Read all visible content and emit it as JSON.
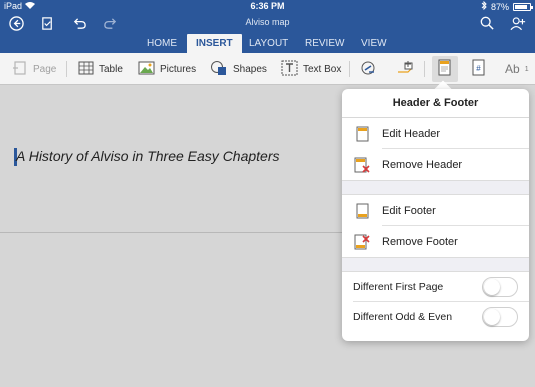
{
  "status": {
    "device": "iPad",
    "time": "6:36 PM",
    "battery": "87%"
  },
  "document": {
    "title": "Alviso map",
    "heading": "A History of Alviso in Three Easy Chapters"
  },
  "tabs": [
    {
      "label": "HOME"
    },
    {
      "label": "INSERT"
    },
    {
      "label": "LAYOUT"
    },
    {
      "label": "REVIEW"
    },
    {
      "label": "VIEW"
    }
  ],
  "ribbon": {
    "page": "Page",
    "table": "Table",
    "pictures": "Pictures",
    "shapes": "Shapes",
    "textbox": "Text Box",
    "wordart": "Ab"
  },
  "popover": {
    "title": "Header & Footer",
    "edit_header": "Edit Header",
    "remove_header": "Remove Header",
    "edit_footer": "Edit Footer",
    "remove_footer": "Remove Footer",
    "different_first_page": "Different First Page",
    "different_odd_even": "Different Odd & Even"
  },
  "colors": {
    "accent": "#2b579a",
    "remove": "#d83b3b",
    "header_icon": "#e9a21f"
  }
}
